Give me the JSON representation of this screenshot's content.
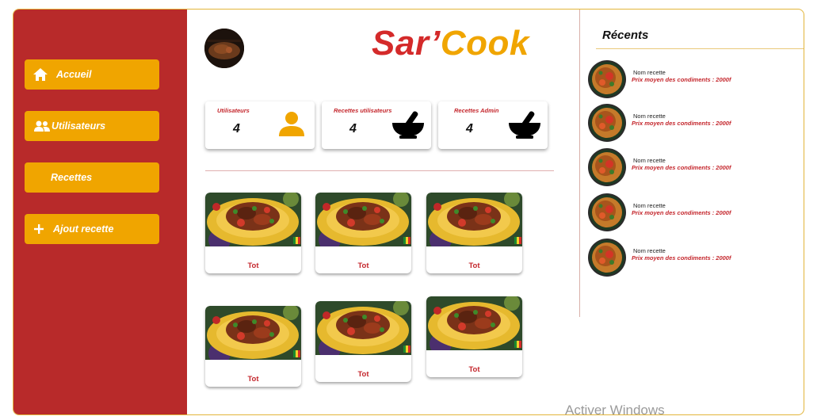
{
  "sidebar": {
    "items": [
      {
        "label": "Accueil",
        "icon": "home-icon"
      },
      {
        "label": "Utilisateurs",
        "icon": "users-icon"
      },
      {
        "label": "Recettes",
        "icon": ""
      },
      {
        "label": "Ajout recette",
        "icon": "plus-icon"
      }
    ]
  },
  "header": {
    "brand_part1": "Sar’",
    "brand_part2": "Cook",
    "avatar_icon": "dish-avatar-icon"
  },
  "stats": [
    {
      "label": "Utilisateurs",
      "value": "4",
      "icon": "user-icon"
    },
    {
      "label": "Recettes utilisateurs",
      "value": "4",
      "icon": "mortar-pestle-icon"
    },
    {
      "label": "Recettes Admin",
      "value": "4",
      "icon": "mortar-pestle-icon"
    }
  ],
  "recipes": [
    {
      "title": "Tot"
    },
    {
      "title": "Tot"
    },
    {
      "title": "Tot"
    },
    {
      "title": "Tot"
    },
    {
      "title": "Tot"
    },
    {
      "title": "Tot"
    }
  ],
  "recent": {
    "title": "Récents",
    "items": [
      {
        "name": "Nom recette",
        "price": "Prix moyen des condiments : 2000f"
      },
      {
        "name": "Nom recette",
        "price": "Prix moyen des condiments : 2000f"
      },
      {
        "name": "Nom recette",
        "price": "Prix moyen des condiments : 2000f"
      },
      {
        "name": "Nom recette",
        "price": "Prix moyen des condiments : 2000f"
      },
      {
        "name": "Nom recette",
        "price": "Prix moyen des condiments : 2000f"
      }
    ]
  },
  "watermark": "Activer Windows",
  "colors": {
    "sidebar": "#b82a2a",
    "accent": "#f0a500",
    "brand_red": "#d42a2a",
    "label_red": "#c4262c"
  }
}
